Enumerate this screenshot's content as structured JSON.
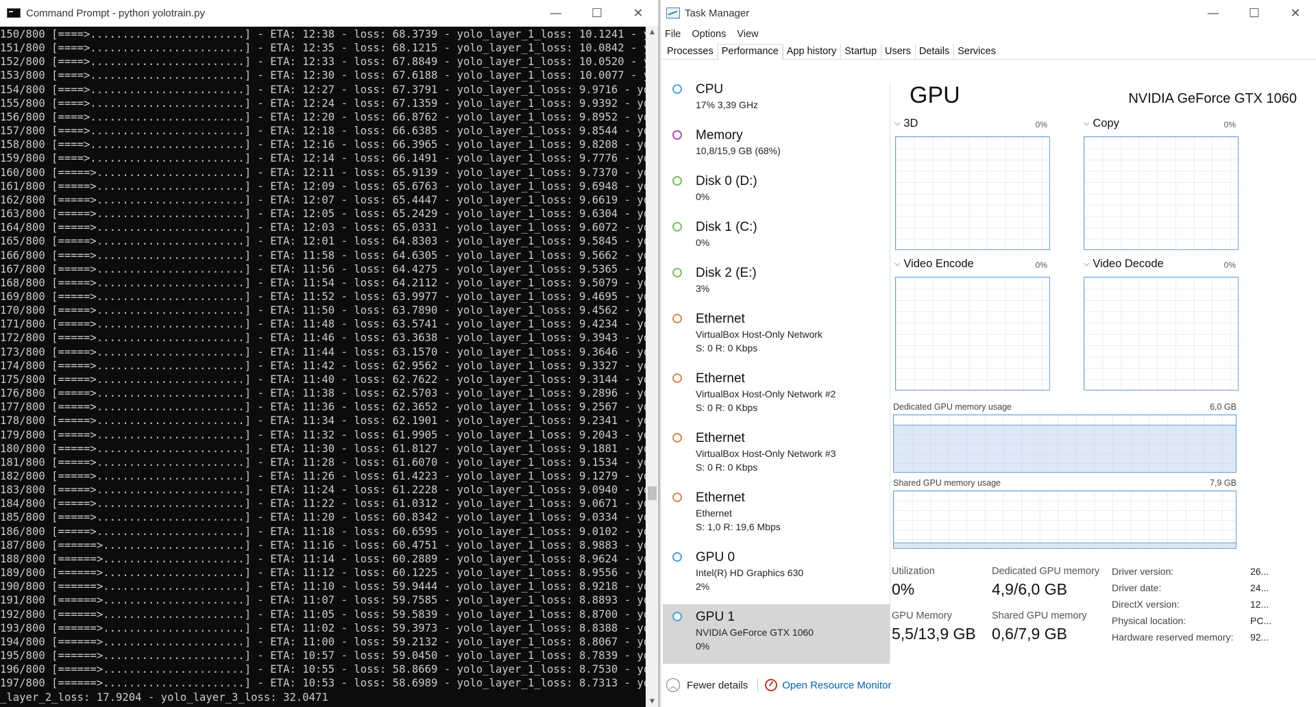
{
  "cmd": {
    "title": "Command Prompt - python  yolotrain.py",
    "lines": [
      "150/800 [====>........................] - ETA: 12:38 - loss: 68.3739 - yolo_layer_1_loss: 10.1241 - yol",
      "151/800 [====>........................] - ETA: 12:35 - loss: 68.1215 - yolo_layer_1_loss: 10.0842 - yol",
      "152/800 [====>........................] - ETA: 12:33 - loss: 67.8849 - yolo_layer_1_loss: 10.0520 - yol",
      "153/800 [====>........................] - ETA: 12:30 - loss: 67.6188 - yolo_layer_1_loss: 10.0077 - yol",
      "154/800 [====>........................] - ETA: 12:27 - loss: 67.3791 - yolo_layer_1_loss: 9.9716 - yolo",
      "155/800 [====>........................] - ETA: 12:24 - loss: 67.1359 - yolo_layer_1_loss: 9.9392 - yolo",
      "156/800 [====>........................] - ETA: 12:20 - loss: 66.8762 - yolo_layer_1_loss: 9.8952 - yolo",
      "157/800 [====>........................] - ETA: 12:18 - loss: 66.6385 - yolo_layer_1_loss: 9.8544 - yolo",
      "158/800 [====>........................] - ETA: 12:16 - loss: 66.3965 - yolo_layer_1_loss: 9.8208 - yolo",
      "159/800 [====>........................] - ETA: 12:14 - loss: 66.1491 - yolo_layer_1_loss: 9.7776 - yolo",
      "160/800 [=====>.......................] - ETA: 12:11 - loss: 65.9139 - yolo_layer_1_loss: 9.7370 - yolo",
      "161/800 [=====>.......................] - ETA: 12:09 - loss: 65.6763 - yolo_layer_1_loss: 9.6948 - yolo",
      "162/800 [=====>.......................] - ETA: 12:07 - loss: 65.4447 - yolo_layer_1_loss: 9.6619 - yolo",
      "163/800 [=====>.......................] - ETA: 12:05 - loss: 65.2429 - yolo_layer_1_loss: 9.6304 - yolo",
      "164/800 [=====>.......................] - ETA: 12:03 - loss: 65.0331 - yolo_layer_1_loss: 9.6072 - yolo",
      "165/800 [=====>.......................] - ETA: 12:01 - loss: 64.8303 - yolo_layer_1_loss: 9.5845 - yolo",
      "166/800 [=====>.......................] - ETA: 11:58 - loss: 64.6305 - yolo_layer_1_loss: 9.5662 - yolo",
      "167/800 [=====>.......................] - ETA: 11:56 - loss: 64.4275 - yolo_layer_1_loss: 9.5365 - yolo",
      "168/800 [=====>.......................] - ETA: 11:54 - loss: 64.2112 - yolo_layer_1_loss: 9.5079 - yolo",
      "169/800 [=====>.......................] - ETA: 11:52 - loss: 63.9977 - yolo_layer_1_loss: 9.4695 - yolo",
      "170/800 [=====>.......................] - ETA: 11:50 - loss: 63.7890 - yolo_layer_1_loss: 9.4562 - yolo",
      "171/800 [=====>.......................] - ETA: 11:48 - loss: 63.5741 - yolo_layer_1_loss: 9.4234 - yolo",
      "172/800 [=====>.......................] - ETA: 11:46 - loss: 63.3638 - yolo_layer_1_loss: 9.3943 - yolo",
      "173/800 [=====>.......................] - ETA: 11:44 - loss: 63.1570 - yolo_layer_1_loss: 9.3646 - yolo",
      "174/800 [=====>.......................] - ETA: 11:42 - loss: 62.9562 - yolo_layer_1_loss: 9.3327 - yolo",
      "175/800 [=====>.......................] - ETA: 11:40 - loss: 62.7622 - yolo_layer_1_loss: 9.3144 - yolo",
      "176/800 [=====>.......................] - ETA: 11:38 - loss: 62.5703 - yolo_layer_1_loss: 9.2896 - yolo",
      "177/800 [=====>.......................] - ETA: 11:36 - loss: 62.3652 - yolo_layer_1_loss: 9.2567 - yolo",
      "178/800 [=====>.......................] - ETA: 11:34 - loss: 62.1901 - yolo_layer_1_loss: 9.2341 - yolo",
      "179/800 [=====>.......................] - ETA: 11:32 - loss: 61.9905 - yolo_layer_1_loss: 9.2043 - yolo",
      "180/800 [=====>.......................] - ETA: 11:30 - loss: 61.8127 - yolo_layer_1_loss: 9.1881 - yolo",
      "181/800 [=====>.......................] - ETA: 11:28 - loss: 61.6070 - yolo_layer_1_loss: 9.1534 - yolo",
      "182/800 [=====>.......................] - ETA: 11:26 - loss: 61.4223 - yolo_layer_1_loss: 9.1279 - yolo",
      "183/800 [=====>.......................] - ETA: 11:24 - loss: 61.2228 - yolo_layer_1_loss: 9.0940 - yolo",
      "184/800 [=====>.......................] - ETA: 11:22 - loss: 61.0312 - yolo_layer_1_loss: 9.0671 - yolo",
      "185/800 [=====>.......................] - ETA: 11:20 - loss: 60.8342 - yolo_layer_1_loss: 9.0334 - yolo",
      "186/800 [=====>.......................] - ETA: 11:18 - loss: 60.6595 - yolo_layer_1_loss: 9.0102 - yolo",
      "187/800 [======>......................] - ETA: 11:16 - loss: 60.4751 - yolo_layer_1_loss: 8.9883 - yolo",
      "188/800 [======>......................] - ETA: 11:14 - loss: 60.2889 - yolo_layer_1_loss: 8.9624 - yolo",
      "189/800 [======>......................] - ETA: 11:12 - loss: 60.1225 - yolo_layer_1_loss: 8.9556 - yolo",
      "190/800 [======>......................] - ETA: 11:10 - loss: 59.9444 - yolo_layer_1_loss: 8.9218 - yolo",
      "191/800 [======>......................] - ETA: 11:07 - loss: 59.7585 - yolo_layer_1_loss: 8.8893 - yolo",
      "192/800 [======>......................] - ETA: 11:05 - loss: 59.5839 - yolo_layer_1_loss: 8.8700 - yolo",
      "193/800 [======>......................] - ETA: 11:02 - loss: 59.3973 - yolo_layer_1_loss: 8.8388 - yolo",
      "194/800 [======>......................] - ETA: 11:00 - loss: 59.2132 - yolo_layer_1_loss: 8.8067 - yolo",
      "195/800 [======>......................] - ETA: 10:57 - loss: 59.0450 - yolo_layer_1_loss: 8.7839 - yolo",
      "196/800 [======>......................] - ETA: 10:55 - loss: 58.8669 - yolo_layer_1_loss: 8.7530 - yolo",
      "197/800 [======>......................] - ETA: 10:53 - loss: 58.6989 - yolo_layer_1_loss: 8.7313 - yolo",
      "_layer_2_loss: 17.9204 - yolo_layer_3_loss: 32.0471"
    ]
  },
  "window_controls": {
    "minimize": "—",
    "maximize": "☐",
    "close": "✕"
  },
  "taskmgr": {
    "title": "Task Manager",
    "menu": [
      "File",
      "Options",
      "View"
    ],
    "tabs": [
      "Processes",
      "Performance",
      "App history",
      "Startup",
      "Users",
      "Details",
      "Services"
    ],
    "active_tab": "Performance",
    "devices": [
      {
        "name": "CPU",
        "sub1": "17%  3,39 GHz",
        "sub2": "",
        "color": "#4aa3df"
      },
      {
        "name": "Memory",
        "sub1": "10,8/15,9 GB (68%)",
        "sub2": "",
        "color": "#a94fc0"
      },
      {
        "name": "Disk 0 (D:)",
        "sub1": "0%",
        "sub2": "",
        "color": "#72c35a"
      },
      {
        "name": "Disk 1 (C:)",
        "sub1": "0%",
        "sub2": "",
        "color": "#72c35a"
      },
      {
        "name": "Disk 2 (E:)",
        "sub1": "3%",
        "sub2": "",
        "color": "#72c35a"
      },
      {
        "name": "Ethernet",
        "sub1": "VirtualBox Host-Only Network",
        "sub2": "S: 0  R: 0 Kbps",
        "color": "#d98a4a"
      },
      {
        "name": "Ethernet",
        "sub1": "VirtualBox Host-Only Network #2",
        "sub2": "S: 0  R: 0 Kbps",
        "color": "#d98a4a"
      },
      {
        "name": "Ethernet",
        "sub1": "VirtualBox Host-Only Network #3",
        "sub2": "S: 0  R: 0 Kbps",
        "color": "#d98a4a"
      },
      {
        "name": "Ethernet",
        "sub1": "Ethernet",
        "sub2": "S: 1,0  R: 19,6 Mbps",
        "color": "#d98a4a"
      },
      {
        "name": "GPU 0",
        "sub1": "Intel(R) HD Graphics 630",
        "sub2": "2%",
        "color": "#4aa3df"
      },
      {
        "name": "GPU 1",
        "sub1": "NVIDIA GeForce GTX 1060",
        "sub2": "0%",
        "color": "#4aa3df"
      }
    ],
    "selected_device": 10,
    "gpu": {
      "title": "GPU",
      "model": "NVIDIA GeForce GTX 1060",
      "engines": [
        {
          "label": "3D",
          "pct": "0%"
        },
        {
          "label": "Copy",
          "pct": "0%"
        },
        {
          "label": "Video Encode",
          "pct": "0%"
        },
        {
          "label": "Video Decode",
          "pct": "0%"
        }
      ],
      "dedicated_label": "Dedicated GPU memory usage",
      "dedicated_max": "6,0 GB",
      "dedicated_fill_fraction": 0.82,
      "shared_label": "Shared GPU memory usage",
      "shared_max": "7,9 GB",
      "shared_fill_fraction": 0.08,
      "stats": {
        "utilization_label": "Utilization",
        "utilization_value": "0%",
        "dedicated_label": "Dedicated GPU memory",
        "dedicated_value": "4,9/6,0 GB",
        "gpu_memory_label": "GPU Memory",
        "gpu_memory_value": "5,5/13,9 GB",
        "shared_label": "Shared GPU memory",
        "shared_value": "0,6/7,9 GB"
      },
      "info": [
        {
          "key": "Driver version:",
          "value": "26..."
        },
        {
          "key": "Driver date:",
          "value": "24..."
        },
        {
          "key": "DirectX version:",
          "value": "12..."
        },
        {
          "key": "Physical location:",
          "value": "PC..."
        },
        {
          "key": "Hardware reserved memory:",
          "value": "92..."
        }
      ]
    },
    "footer": {
      "fewer_details": "Fewer details",
      "open_resource_monitor": "Open Resource Monitor"
    }
  }
}
